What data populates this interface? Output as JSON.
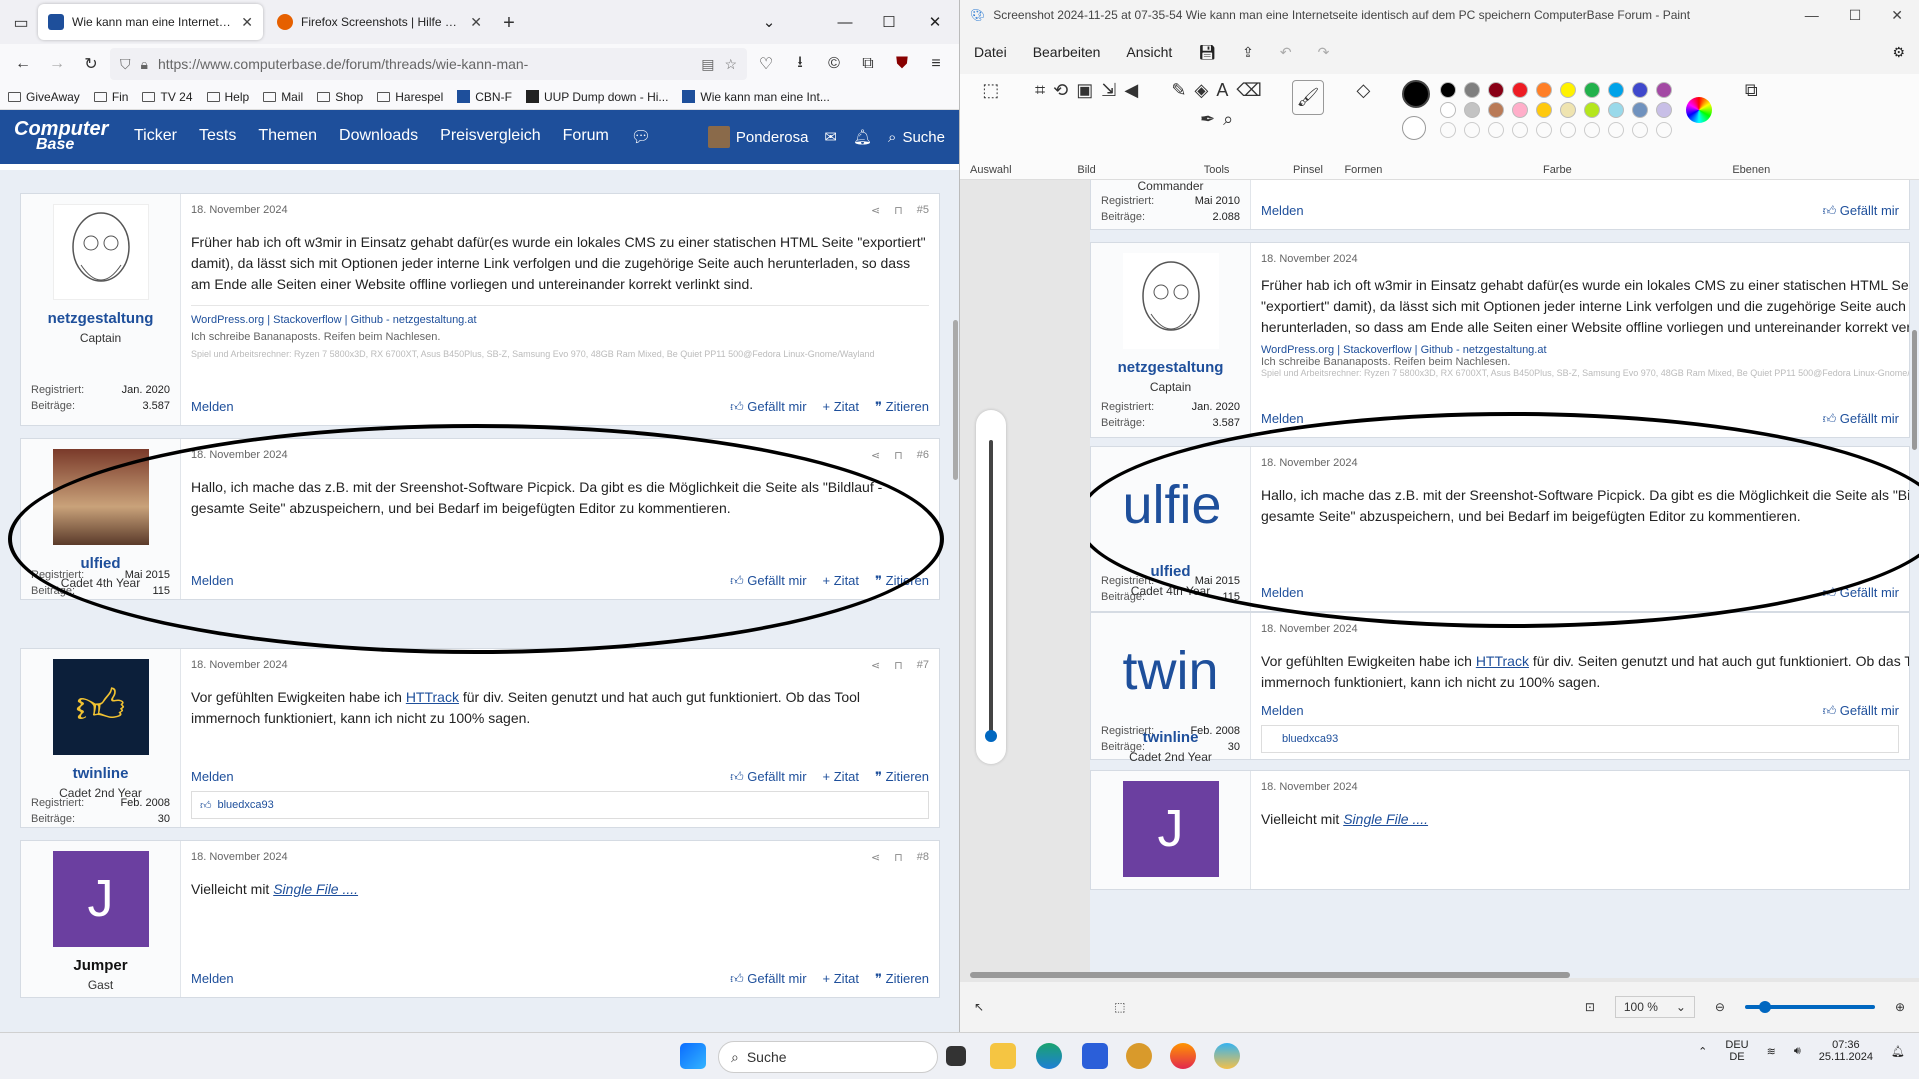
{
  "firefox": {
    "tabs": [
      {
        "title": "Wie kann man eine Internetseite",
        "active": true
      },
      {
        "title": "Firefox Screenshots | Hilfe zu Fi",
        "active": false
      }
    ],
    "url": "https://www.computerbase.de/forum/threads/wie-kann-man-",
    "bookmarks": [
      "GiveAway",
      "Fin",
      "TV 24",
      "Help",
      "Mail",
      "Shop",
      "Harespel",
      "CBN-F",
      "UUP Dump down - Hi...",
      "Wie kann man eine Int..."
    ],
    "site": {
      "logo_line1": "Computer",
      "logo_line2": "Base",
      "nav": [
        "Ticker",
        "Tests",
        "Themen",
        "Downloads",
        "Preisvergleich",
        "Forum"
      ],
      "user": "Ponderosa",
      "search": "Suche"
    }
  },
  "posts": [
    {
      "num": "#5",
      "date": "18. November 2024",
      "user": "netzgestaltung",
      "rank": "Captain",
      "registered_label": "Registriert:",
      "registered": "Jan. 2020",
      "posts_label": "Beiträge:",
      "posts_count": "3.587",
      "text": "Früher hab ich oft w3mir in Einsatz gehabt dafür(es wurde ein lokales CMS zu einer statischen HTML Seite \"exportiert\" damit), da lässt sich mit Optionen jeder interne Link verfolgen und die zugehörige Seite auch herunterladen, so dass am Ende alle Seiten einer Website offline vorliegen und untereinander korrekt verlinkt sind.",
      "sig_links": "WordPress.org | Stackoverflow | Github - netzgestaltung.at",
      "sig_line2": "Ich schreibe Bananaposts. Reifen beim Nachlesen.",
      "sig_line3": "Spiel und Arbeitsrechner: Ryzen 7 5800x3D, RX 6700XT, Asus B450Plus, SB-Z, Samsung Evo 970, 48GB Ram Mixed, Be Quiet PP11 500@Fedora Linux-Gnome/Wayland"
    },
    {
      "num": "#6",
      "date": "18. November 2024",
      "user": "ulfied",
      "rank": "Cadet 4th Year",
      "registered_label": "Registriert:",
      "registered": "Mai 2015",
      "posts_label": "Beiträge:",
      "posts_count": "115",
      "text": "Hallo, ich mache das z.B. mit der Sreenshot-Software Picpick. Da gibt es die Möglichkeit die Seite als \"Bildlauf - gesamte Seite\" abzuspeichern, und bei Bedarf im beigefügten Editor zu kommentieren."
    },
    {
      "num": "#7",
      "date": "18. November 2024",
      "user": "twinline",
      "rank": "Cadet 2nd Year",
      "registered_label": "Registriert:",
      "registered": "Feb. 2008",
      "posts_label": "Beiträge:",
      "posts_count": "30",
      "text_before": "Vor gefühlten Ewigkeiten habe ich ",
      "text_link": "HTTrack",
      "text_after": " für div. Seiten genutzt und hat auch gut funktioniert. Ob das Tool immernoch funktioniert, kann ich nicht zu 100% sagen.",
      "reaction_user": "bluedxca93"
    },
    {
      "num": "#8",
      "date": "18. November 2024",
      "user": "Jumper",
      "rank": "Gast",
      "avatar_letter": "J",
      "text_before": "Vielleicht mit ",
      "text_link": "Single File ...."
    }
  ],
  "post_actions": {
    "report": "Melden",
    "like": "Gefällt mir",
    "quote_plus": "+ Zitat",
    "quote": "Zitieren"
  },
  "paint": {
    "title": "Screenshot 2024-11-25 at 07-35-54 Wie kann man eine Internetseite identisch auf dem PC speichern ComputerBase Forum - Paint",
    "menu": [
      "Datei",
      "Bearbeiten",
      "Ansicht"
    ],
    "groups": [
      "Auswahl",
      "Bild",
      "Tools",
      "Pinsel",
      "Formen",
      "Farbe",
      "Ebenen"
    ],
    "colors_row1": [
      "#000000",
      "#7f7f7f",
      "#880015",
      "#ed1c24",
      "#ff7f27",
      "#fff200",
      "#22b14c",
      "#00a2e8",
      "#3f48cc",
      "#a349a4"
    ],
    "colors_row2": [
      "#ffffff",
      "#c3c3c3",
      "#b97a57",
      "#ffaec9",
      "#ffc90e",
      "#efe4b0",
      "#b5e61d",
      "#99d9ea",
      "#7092be",
      "#c8bfe7"
    ],
    "canvas_top_rank": "Commander",
    "canvas_top_registered": "Mai 2010",
    "canvas_top_posts": "2.088",
    "canvas_avatar_text_ulfied": "ulfie",
    "canvas_avatar_text_twinline": "twin",
    "zoom": "100 %"
  },
  "taskbar": {
    "search": "Suche",
    "lang1": "DEU",
    "lang2": "DE",
    "time": "07:36",
    "date": "25.11.2024"
  }
}
